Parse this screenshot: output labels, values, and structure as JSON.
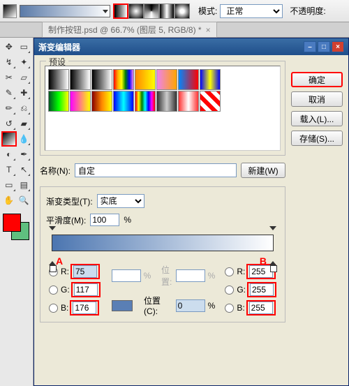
{
  "toolbar": {
    "mode_label": "模式:",
    "mode_value": "正常",
    "opacity_label": "不透明度:"
  },
  "doc_tab": {
    "title": "制作按钮.psd @ 66.7% (图层 5, RGB/8) *",
    "close": "×"
  },
  "dialog": {
    "title": "渐变编辑器",
    "presets_label": "预设",
    "ok": "确定",
    "cancel": "取消",
    "load": "载入(L)...",
    "save": "存储(S)...",
    "name_label": "名称(N):",
    "name_value": "自定",
    "new_btn": "新建(W)",
    "grad_type_label": "渐变类型(T):",
    "grad_type_value": "实底",
    "smooth_label": "平滑度(M):",
    "smooth_value": "100",
    "percent": "%",
    "position_label_dim": "位置:",
    "position_label": "位置(C):",
    "position_value": "0"
  },
  "annotations": {
    "a": "A",
    "b": "B"
  },
  "rgb_left": {
    "r": "75",
    "g": "117",
    "b": "176"
  },
  "rgb_right": {
    "r": "255",
    "g": "255",
    "b": "255"
  },
  "labels": {
    "r": "R:",
    "g": "G:",
    "b": "B:"
  },
  "preset_gradients": [
    "linear-gradient(90deg,#000,#fff)",
    "linear-gradient(90deg,#000,transparent)",
    "linear-gradient(90deg,#000,#fff)",
    "linear-gradient(90deg,red,orange,yellow,green,blue,violet)",
    "linear-gradient(90deg,#f80,#ff0)",
    "linear-gradient(90deg,violet,orange)",
    "linear-gradient(90deg,#08f,#f00)",
    "linear-gradient(90deg,blue,yellow,blue)",
    "linear-gradient(90deg,#052,#0f0,#ff0)",
    "linear-gradient(90deg,#f0f,#ff0)",
    "linear-gradient(90deg,#800,#f80,#ff0)",
    "linear-gradient(90deg,#00f,#0ff,#00f)",
    "linear-gradient(90deg,red,yellow,green,cyan,blue,magenta,red)",
    "linear-gradient(90deg,#333,#ccc,#333)",
    "linear-gradient(90deg,#f33,#fff,#f33)",
    "repeating-linear-gradient(45deg,#f00 0 6px,#fff 6px 12px)"
  ]
}
